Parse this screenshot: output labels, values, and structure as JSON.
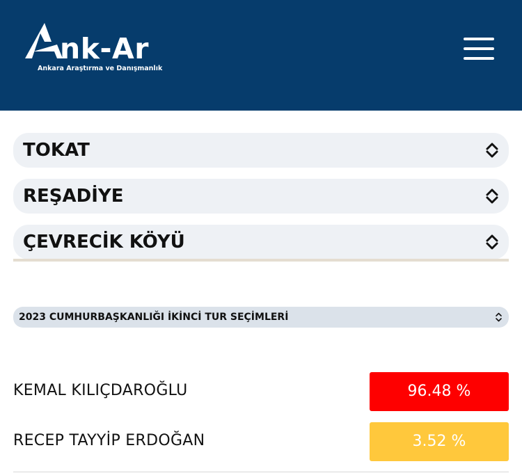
{
  "header": {
    "brand_name": "nk-Ar",
    "brand_tagline": "Ankara Araştırma ve Danışmanlık",
    "brand_color": "#063c6c",
    "menu_icon": "hamburger-menu-icon"
  },
  "location": {
    "province": "TOKAT",
    "district": "REŞADİYE",
    "village": "ÇEVRECİK KÖYÜ"
  },
  "election": {
    "selected": "2023 CUMHURBAŞKANLIĞI İKİNCİ TUR SEÇİMLERİ"
  },
  "results": [
    {
      "name": "KEMAL KILIÇDAROĞLU",
      "percent": "96.48 %",
      "color": "#fe0000"
    },
    {
      "name": "RECEP TAYYİP ERDOĞAN",
      "percent": "3.52 %",
      "color": "#ffc83c"
    }
  ]
}
